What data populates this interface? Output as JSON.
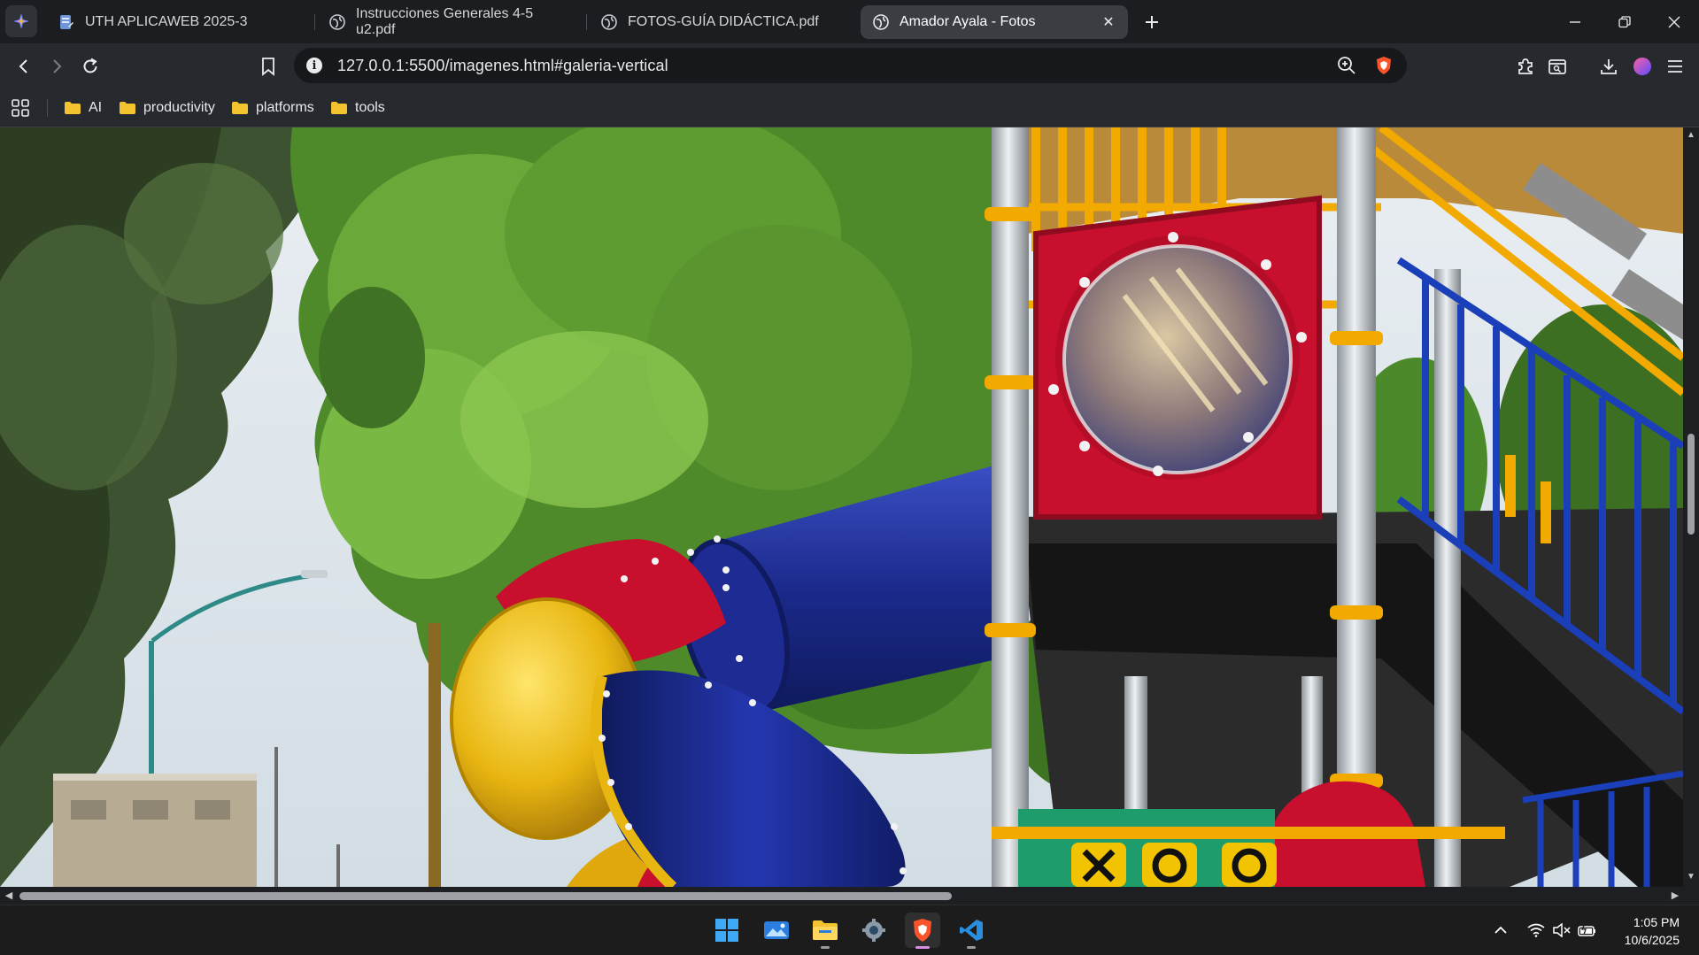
{
  "browser": {
    "tabs": [
      {
        "label": "UTH APLICAWEB 2025-3",
        "icon": "document-icon",
        "active": false
      },
      {
        "label": "Instrucciones Generales 4-5 u2.pdf",
        "icon": "globe-icon",
        "active": false
      },
      {
        "label": "FOTOS-GUÍA DIDÁCTICA.pdf",
        "icon": "globe-icon",
        "active": false
      },
      {
        "label": "Amador Ayala - Fotos",
        "icon": "globe-icon",
        "active": true
      }
    ],
    "url": "127.0.0.1:5500/imagenes.html#galeria-vertical",
    "bookmarks": [
      {
        "label": "AI"
      },
      {
        "label": "productivity"
      },
      {
        "label": "platforms"
      },
      {
        "label": "tools"
      }
    ]
  },
  "content": {
    "image_subject": "playground",
    "colors": {
      "slide_blue": "#1b2a8c",
      "slide_yellow": "#e8b611",
      "panel_red": "#c8102e",
      "railing_blue": "#1a3fb8",
      "frame_orange": "#f2a900"
    }
  },
  "taskbar": {
    "apps": [
      "start-icon",
      "photos-icon",
      "file-explorer-icon",
      "settings-icon",
      "brave-icon",
      "vscode-icon"
    ],
    "time": "1:05 PM",
    "date": "10/6/2025"
  },
  "accent": "#d98ee6"
}
